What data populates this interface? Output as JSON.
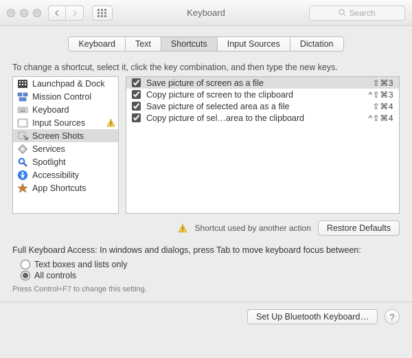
{
  "window": {
    "title": "Keyboard",
    "search_placeholder": "Search"
  },
  "tabs": [
    {
      "label": "Keyboard",
      "selected": false
    },
    {
      "label": "Text",
      "selected": false
    },
    {
      "label": "Shortcuts",
      "selected": true
    },
    {
      "label": "Input Sources",
      "selected": false
    },
    {
      "label": "Dictation",
      "selected": false
    }
  ],
  "instructions": "To change a shortcut, select it, click the key combination, and then type the new keys.",
  "sidebar": {
    "items": [
      {
        "label": "Launchpad & Dock",
        "icon": "launchpad",
        "warning": false,
        "selected": false
      },
      {
        "label": "Mission Control",
        "icon": "mission-control",
        "warning": false,
        "selected": false
      },
      {
        "label": "Keyboard",
        "icon": "keyboard",
        "warning": false,
        "selected": false
      },
      {
        "label": "Input Sources",
        "icon": "input-sources",
        "warning": true,
        "selected": false
      },
      {
        "label": "Screen Shots",
        "icon": "screenshots",
        "warning": false,
        "selected": true
      },
      {
        "label": "Services",
        "icon": "services",
        "warning": false,
        "selected": false
      },
      {
        "label": "Spotlight",
        "icon": "spotlight",
        "warning": false,
        "selected": false
      },
      {
        "label": "Accessibility",
        "icon": "accessibility",
        "warning": false,
        "selected": false
      },
      {
        "label": "App Shortcuts",
        "icon": "app-shortcuts",
        "warning": false,
        "selected": false
      }
    ]
  },
  "shortcuts": [
    {
      "enabled": true,
      "label": "Save picture of screen as a file",
      "keys": "⇧⌘3",
      "selected": true
    },
    {
      "enabled": true,
      "label": "Copy picture of screen to the clipboard",
      "keys": "^⇧⌘3",
      "selected": false
    },
    {
      "enabled": true,
      "label": "Save picture of selected area as a file",
      "keys": "⇧⌘4",
      "selected": false
    },
    {
      "enabled": true,
      "label": "Copy picture of sel…area to the clipboard",
      "keys": "^⇧⌘4",
      "selected": false
    }
  ],
  "conflict_note": "Shortcut used by another action",
  "restore_defaults_label": "Restore Defaults",
  "full_keyboard_access": {
    "label": "Full Keyboard Access: In windows and dialogs, press Tab to move keyboard focus between:",
    "options": [
      {
        "label": "Text boxes and lists only",
        "selected": false
      },
      {
        "label": "All controls",
        "selected": true
      }
    ],
    "hint": "Press Control+F7 to change this setting."
  },
  "footer": {
    "setup_bluetooth_label": "Set Up Bluetooth Keyboard…"
  }
}
